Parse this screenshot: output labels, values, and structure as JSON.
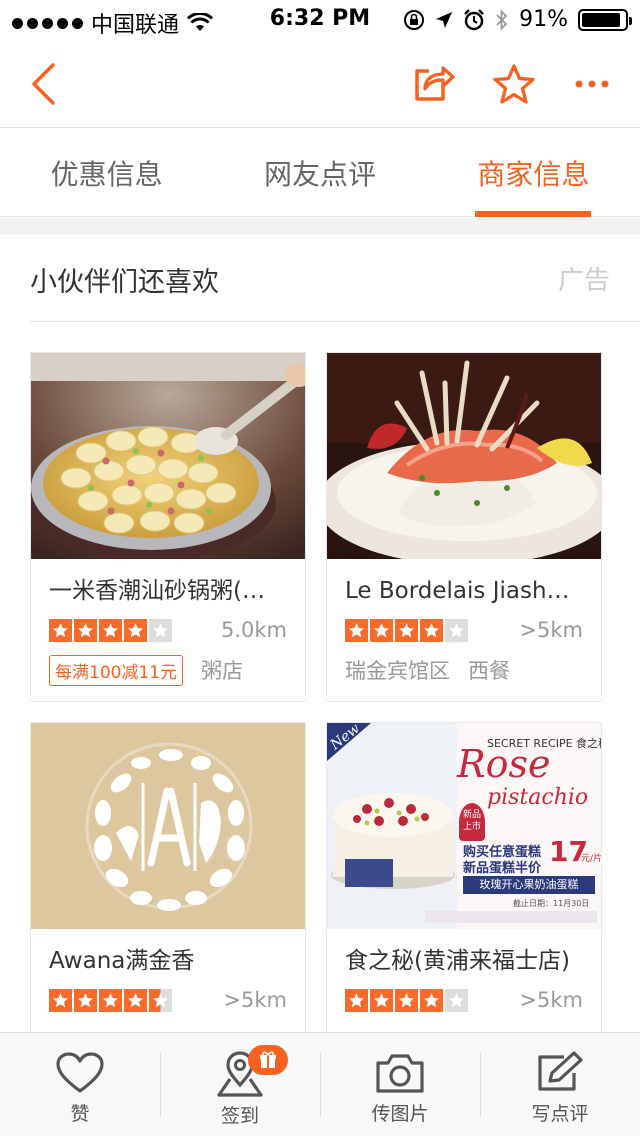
{
  "status_bar": {
    "carrier": "中国联通",
    "time": "6:32 PM",
    "battery": "91%",
    "battery_level": 0.91
  },
  "nav": {
    "icons": [
      "back-arrow-icon",
      "share-icon",
      "star-icon",
      "more-icon"
    ]
  },
  "tabs": [
    {
      "label": "优惠信息"
    },
    {
      "label": "网友点评"
    },
    {
      "label": "商家信息"
    }
  ],
  "active_tab": 2,
  "section": {
    "title": "小伙伴们还喜欢",
    "ad_label": "广告"
  },
  "cards": [
    {
      "name": "一米香潮汕砂锅粥(…",
      "rating": 4,
      "distance": "5.0km",
      "promo": "每满100减11元",
      "tags": [
        "粥店"
      ],
      "image": "congee-tofu-photo"
    },
    {
      "name": "Le Bordelais Jiasha…",
      "rating": 4,
      "distance": ">5km",
      "promo": "",
      "tags": [
        "瑞金宾馆区",
        "西餐"
      ],
      "image": "salmon-salad-photo"
    },
    {
      "name": "Awana满金香",
      "rating": 4.5,
      "distance": ">5km",
      "promo": "",
      "tags": [],
      "image": "awana-logo"
    },
    {
      "name": "食之秘(黄浦来福士店)",
      "rating": 4,
      "distance": ">5km",
      "promo": "",
      "tags": [],
      "image": "rose-pistachio-cake-ad"
    }
  ],
  "cake_ad": {
    "new_badge": "New",
    "brand": "SECRET RECIPE 食之秘",
    "title_line1": "Rose",
    "title_line2": "pistachio",
    "badge": "新品上市",
    "offer_line1": "购买任意蛋糕",
    "offer_line2": "新品蛋糕半价",
    "price": "17",
    "price_unit": "元/片",
    "product_name": "玫瑰开心果奶油蛋糕",
    "end_date": "截止日期：11月30日"
  },
  "bottom_bar": [
    {
      "label": "赞",
      "icon": "heart-icon"
    },
    {
      "label": "签到",
      "icon": "location-pin-icon"
    },
    {
      "label": "传图片",
      "icon": "camera-icon"
    },
    {
      "label": "写点评",
      "icon": "edit-icon"
    }
  ],
  "colors": {
    "accent": "#f76120",
    "star": "#f76a2a"
  }
}
